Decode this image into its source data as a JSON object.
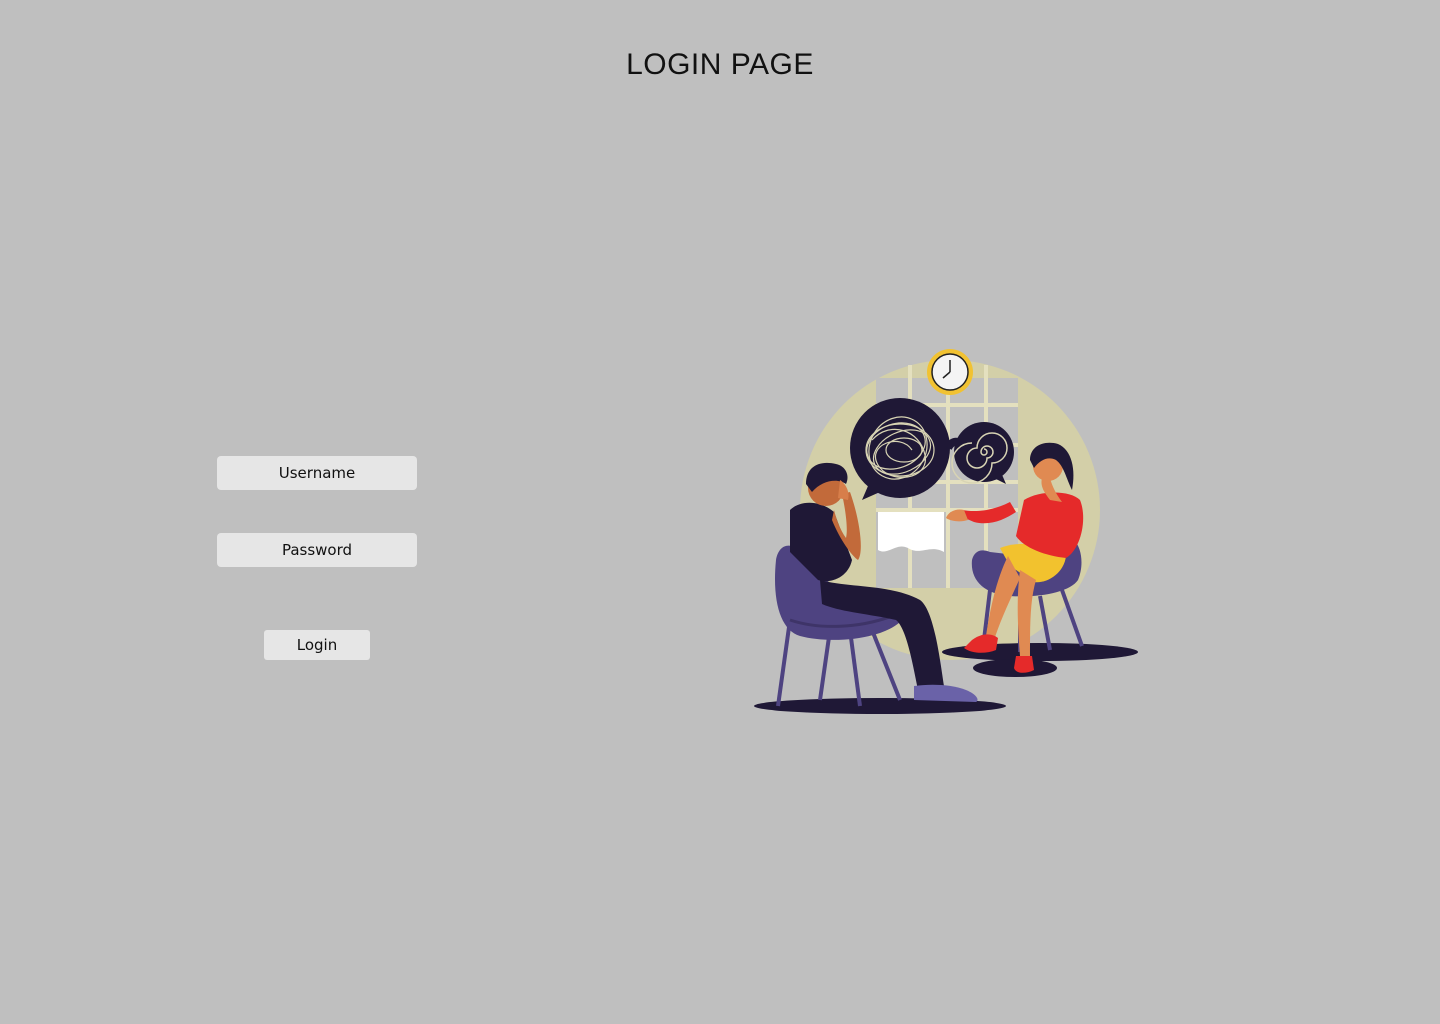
{
  "page": {
    "title": "LOGIN PAGE",
    "background": "#bfbfbf"
  },
  "form": {
    "username_placeholder": "Username",
    "password_placeholder": "Password",
    "login_label": "Login",
    "field_background": "#e6e6e6"
  },
  "illustration": {
    "subject": "therapy-session",
    "colors": {
      "backdrop": "#d3cfa8",
      "dark": "#1f1836",
      "chair": "#4e4381",
      "woman_shirt": "#e52a2a",
      "woman_skirt": "#f2c22e",
      "skin": "#e08a52",
      "clock_ring": "#f1c232"
    }
  }
}
